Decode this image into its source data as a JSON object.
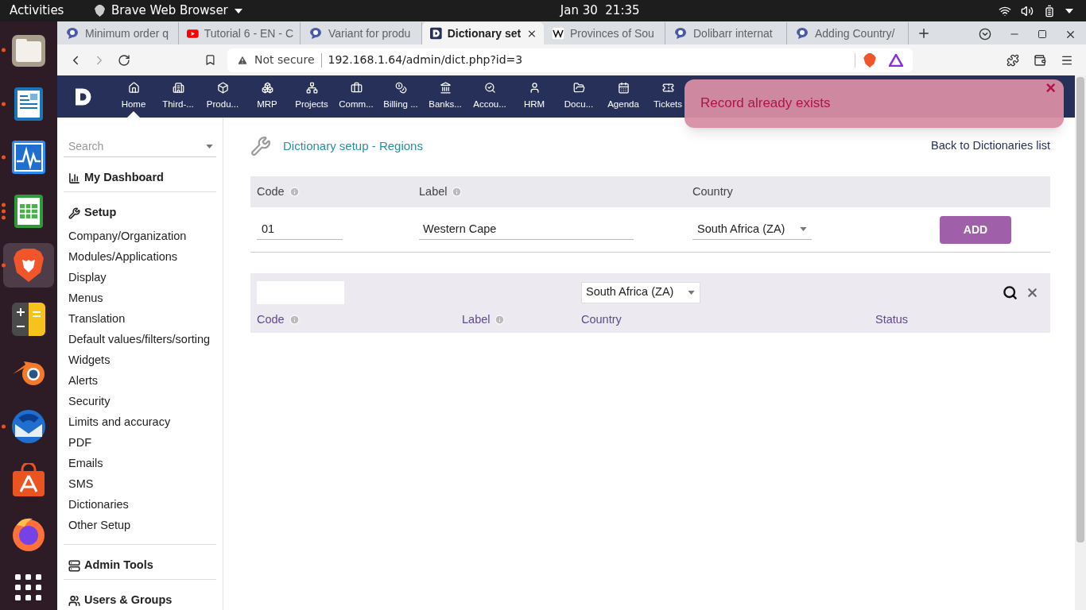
{
  "topbar": {
    "activities": "Activities",
    "app_menu": "Brave Web Browser",
    "clock": "Jan 30  21:35"
  },
  "dock": [
    {
      "kind": "files",
      "running": true,
      "multiple_windows": false,
      "selected": false
    },
    {
      "kind": "writer",
      "running": true,
      "multiple_windows": false,
      "selected": false
    },
    {
      "kind": "monitor",
      "running": true,
      "multiple_windows": false,
      "selected": false
    },
    {
      "kind": "calc",
      "running": true,
      "multiple_windows": true,
      "selected": false
    },
    {
      "kind": "brave",
      "running": true,
      "multiple_windows": false,
      "selected": true
    },
    {
      "kind": "calculator",
      "running": false,
      "selected": false
    },
    {
      "kind": "blender",
      "running": false,
      "selected": false
    },
    {
      "kind": "thunderbird",
      "running": true,
      "multiple_windows": false,
      "selected": false
    },
    {
      "kind": "store",
      "running": false,
      "selected": false
    },
    {
      "kind": "firefox",
      "running": false,
      "selected": false
    },
    {
      "kind": "apps",
      "running": false,
      "selected": false
    }
  ],
  "tabs": [
    {
      "title": "Minimum order q",
      "kind": "dolibarr",
      "selected": false
    },
    {
      "title": "Tutorial 6 - EN - C",
      "kind": "youtube",
      "selected": false
    },
    {
      "title": "Variant for produ",
      "kind": "dolibarr",
      "selected": false
    },
    {
      "title": "Dictionary set",
      "kind": "dict",
      "selected": true
    },
    {
      "title": "Provinces of Sou",
      "kind": "wiki",
      "selected": false
    },
    {
      "title": "Dolibarr internat",
      "kind": "dolibarr",
      "selected": false
    },
    {
      "title": "Adding Country/",
      "kind": "dolibarr",
      "selected": false
    }
  ],
  "address": {
    "security": "Not secure",
    "url": "192.168.1.64/admin/dict.php?id=3"
  },
  "nav": [
    {
      "label": "Home",
      "selected": true
    },
    {
      "label": "Third-...",
      "selected": false
    },
    {
      "label": "Produ...",
      "selected": false
    },
    {
      "label": "MRP",
      "selected": false
    },
    {
      "label": "Projects",
      "selected": false
    },
    {
      "label": "Comm...",
      "selected": false
    },
    {
      "label": "Billing ...",
      "selected": false
    },
    {
      "label": "Banks...",
      "selected": false
    },
    {
      "label": "Accou...",
      "selected": false
    },
    {
      "label": "HRM",
      "selected": false
    },
    {
      "label": "Docu...",
      "selected": false
    },
    {
      "label": "Agenda",
      "selected": false
    },
    {
      "label": "Tickets",
      "selected": false
    }
  ],
  "toast": {
    "message": "Record already exists",
    "close": "×"
  },
  "sidebar": {
    "search_placeholder": "Search",
    "sections": [
      {
        "title": "My Dashboard"
      },
      {
        "title": "Setup",
        "items": [
          "Company/Organization",
          "Modules/Applications",
          "Display",
          "Menus",
          "Translation",
          "Default values/filters/sorting",
          "Widgets",
          "Alerts",
          "Security",
          "Limits and accuracy",
          "PDF",
          "Emails",
          "SMS",
          "Dictionaries",
          "Other Setup"
        ]
      },
      {
        "title": "Admin Tools"
      },
      {
        "title": "Users & Groups"
      }
    ]
  },
  "content": {
    "title": "Dictionary setup - Regions",
    "back_link": "Back to Dictionaries list",
    "form": {
      "columns": [
        {
          "label": "Code",
          "info": true
        },
        {
          "label": "Label",
          "info": true
        },
        {
          "label": "Country",
          "info": false
        }
      ],
      "code": "01",
      "label": "Western Cape",
      "country": "South Africa (ZA)",
      "button": "ADD"
    },
    "list": {
      "country_filter": "South Africa (ZA)",
      "columns": [
        {
          "label": "Code",
          "info": true
        },
        {
          "label": "Label",
          "info": true
        },
        {
          "label": "Country",
          "info": false
        },
        {
          "label": "Status",
          "info": false
        }
      ]
    }
  }
}
